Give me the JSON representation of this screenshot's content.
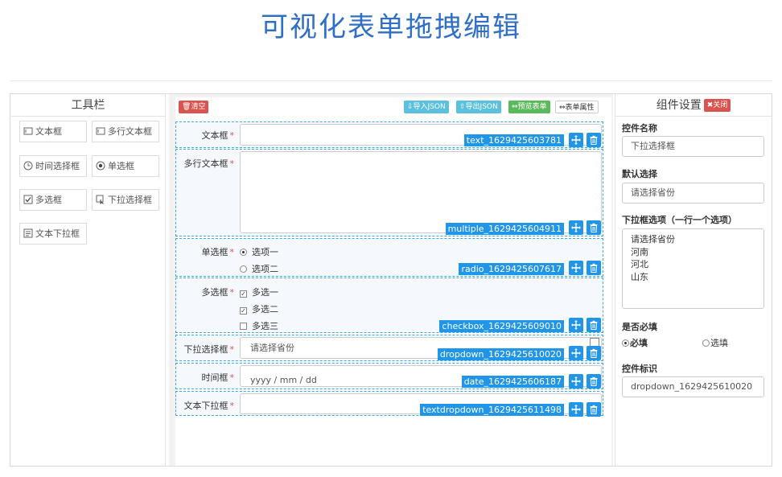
{
  "page": {
    "title": "可视化表单拖拽编辑"
  },
  "toolbar": {
    "heading": "工具栏",
    "items": [
      {
        "label": "文本框",
        "icon": "textbox-icon"
      },
      {
        "label": "多行文本框",
        "icon": "textarea-icon"
      },
      {
        "label": "时间选择框",
        "icon": "clock-icon"
      },
      {
        "label": "单选框",
        "icon": "radio-icon"
      },
      {
        "label": "多选框",
        "icon": "checkbox-icon"
      },
      {
        "label": "下拉选择框",
        "icon": "dropdown-icon"
      },
      {
        "label": "文本下拉框",
        "icon": "text-dropdown-icon"
      }
    ]
  },
  "actions": {
    "clear": "清空",
    "import_json": "导入JSON",
    "export_json": "导出JSON",
    "preview": "预览表单",
    "form_attrs": "表单属性"
  },
  "form": {
    "fields": [
      {
        "label": "文本框",
        "id": "text_1629425603781"
      },
      {
        "label": "多行文本框",
        "id": "multiple_1629425604911"
      },
      {
        "label": "单选框",
        "id": "radio_1629425607617",
        "options": [
          "选项一",
          "选项二"
        ],
        "selected": 0
      },
      {
        "label": "多选框",
        "id": "checkbox_1629425609010",
        "options": [
          "多选一",
          "多选二",
          "多选三"
        ],
        "checked": [
          true,
          true,
          false
        ]
      },
      {
        "label": "下拉选择框",
        "id": "dropdown_1629425610020",
        "value": "请选择省份"
      },
      {
        "label": "时间框",
        "id": "date_1629425606187",
        "placeholder": "yyyy / mm / dd"
      },
      {
        "label": "文本下拉框",
        "id": "textdropdown_1629425611498"
      }
    ],
    "required_mark": "*"
  },
  "settings": {
    "heading": "组件设置",
    "close": "关闭",
    "name_label": "控件名称",
    "name_value": "下拉选择框",
    "default_label": "默认选择",
    "default_value": "请选择省份",
    "options_label": "下拉框选项（一行一个选项）",
    "options": [
      "请选择省份",
      "河南",
      "河北",
      "山东"
    ],
    "required_label": "是否必填",
    "required_yes": "必填",
    "required_no": "选填",
    "required_selected": "必填",
    "id_label": "控件标识",
    "id_value": "dropdown_1629425610020"
  },
  "colors": {
    "title_blue": "#2f6fc6",
    "accent_blue": "#2196e8",
    "danger_red": "#d9534f",
    "info_cyan": "#5bc0de",
    "success_green": "#5cb85c"
  }
}
